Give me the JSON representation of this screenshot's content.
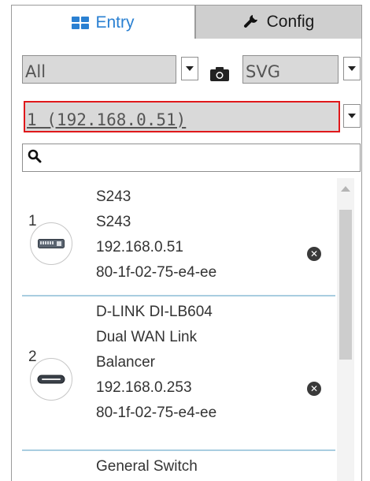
{
  "tabs": {
    "entry_label": "Entry",
    "entry_icon": "grid-icon",
    "config_label": "Config",
    "config_icon": "wrench-icon"
  },
  "filters": {
    "type_selected": "All",
    "format_selected": "SVG",
    "snapshot_icon": "camera-icon"
  },
  "device_select": {
    "selected": "1 (192.168.0.51)"
  },
  "search": {
    "placeholder": "",
    "value": ""
  },
  "devices": [
    {
      "index": "1",
      "icon": "switch-icon",
      "lines": [
        "S243",
        "S243",
        "192.168.0.51",
        "80-1f-02-75-e4-ee"
      ]
    },
    {
      "index": "2",
      "icon": "router-icon",
      "lines": [
        "D-LINK DI-LB604",
        "Dual WAN Link",
        "Balancer",
        "192.168.0.253",
        "80-1f-02-75-e4-ee"
      ]
    },
    {
      "index": "",
      "icon": "",
      "lines": [
        "General Switch"
      ]
    }
  ],
  "colors": {
    "accent": "#2a80d2",
    "highlight_border": "#e0181b",
    "divider": "#a9cde0"
  }
}
